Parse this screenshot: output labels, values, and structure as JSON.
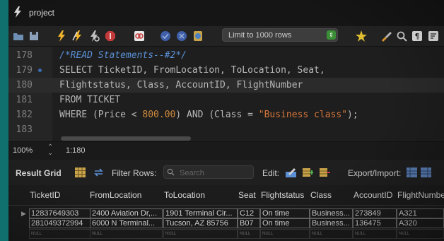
{
  "window": {
    "tab_title": "project"
  },
  "toolbar": {
    "limit_label": "Limit to 1000 rows",
    "icons": [
      "open-folder-icon",
      "save-icon",
      "execute-icon",
      "execute-current-icon",
      "explain-icon",
      "stop-icon",
      "toggle-autocommit-icon",
      "commit-icon",
      "rollback-icon",
      "beautify-icon",
      "limit-dropdown",
      "bookmark-icon",
      "brush-icon",
      "find-icon",
      "invisible-chars-icon",
      "wrap-icon"
    ]
  },
  "editor": {
    "lines": [
      {
        "num": "178",
        "text": "/*READ Statements--#2*/"
      },
      {
        "num": "179",
        "text": "SELECT TicketID, FromLocation, ToLocation, Seat,"
      },
      {
        "num": "180",
        "text": "Flightstatus, Class, AccountID, FlightNumber"
      },
      {
        "num": "181",
        "text": "FROM TICKET"
      },
      {
        "num": "182",
        "text_parts": {
          "a": "WHERE (Price < ",
          "b": "800.00",
          "c": ") AND (Class = ",
          "d": "\"Business class\"",
          "e": ");"
        }
      },
      {
        "num": "183",
        "text": ""
      }
    ]
  },
  "status": {
    "zoom": "100%",
    "spinner": "⌃\n⌄",
    "position": "1:180"
  },
  "result_bar": {
    "title": "Result Grid",
    "filter_label": "Filter Rows:",
    "search_placeholder": "Search",
    "edit_label": "Edit:",
    "export_label": "Export/Import:"
  },
  "grid": {
    "columns": [
      "TicketID",
      "FromLocation",
      "ToLocation",
      "Seat",
      "Flightstatus",
      "Class",
      "AccountID",
      "FlightNumbe"
    ],
    "rows": [
      [
        "12837649303",
        "2400 Aviation Dr,...",
        "1901 Terminal Cir...",
        "C12",
        "On time",
        "Business...",
        "273849",
        "A321"
      ],
      [
        "281049372994",
        "6000 N Terminal...",
        "Tucson, AZ 85756",
        "B07",
        "On time",
        "Business...",
        "136475",
        "A320"
      ],
      [
        "NULL",
        "NULL",
        "NULL",
        "NULL",
        "NULL",
        "NULL",
        "NULL",
        "NULL"
      ]
    ],
    "row_marker": "▶"
  },
  "colors": {
    "accent": "#3b8f36",
    "comment": "#5a8fd6",
    "number": "#d08a3c",
    "string": "#d6763a",
    "background": "#10706e"
  }
}
